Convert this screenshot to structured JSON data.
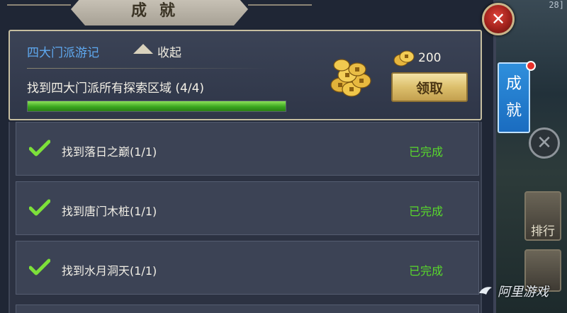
{
  "screen": {
    "title": "成就",
    "counter": "28]"
  },
  "achievement": {
    "category": "四大门派游记",
    "collapse_label": "收起",
    "task": "找到四大门派所有探索区域 (4/4)",
    "progress": 1.0,
    "reward_amount": "200",
    "claim_label": "领取"
  },
  "sub_tasks": [
    {
      "label": "找到落日之巅(1/1)",
      "status": "已完成"
    },
    {
      "label": "找到唐门木桩(1/1)",
      "status": "已完成"
    },
    {
      "label": "找到水月洞天(1/1)",
      "status": "已完成"
    }
  ],
  "side": {
    "tab_line1": "成",
    "tab_line2": "就",
    "rank_label": "排行"
  },
  "watermark": "阿里游戏",
  "colors": {
    "progress": "#3aa61f",
    "done": "#59d82c",
    "category": "#5fa9f0",
    "tab": "#1a6cc0",
    "close": "#a0211b"
  }
}
